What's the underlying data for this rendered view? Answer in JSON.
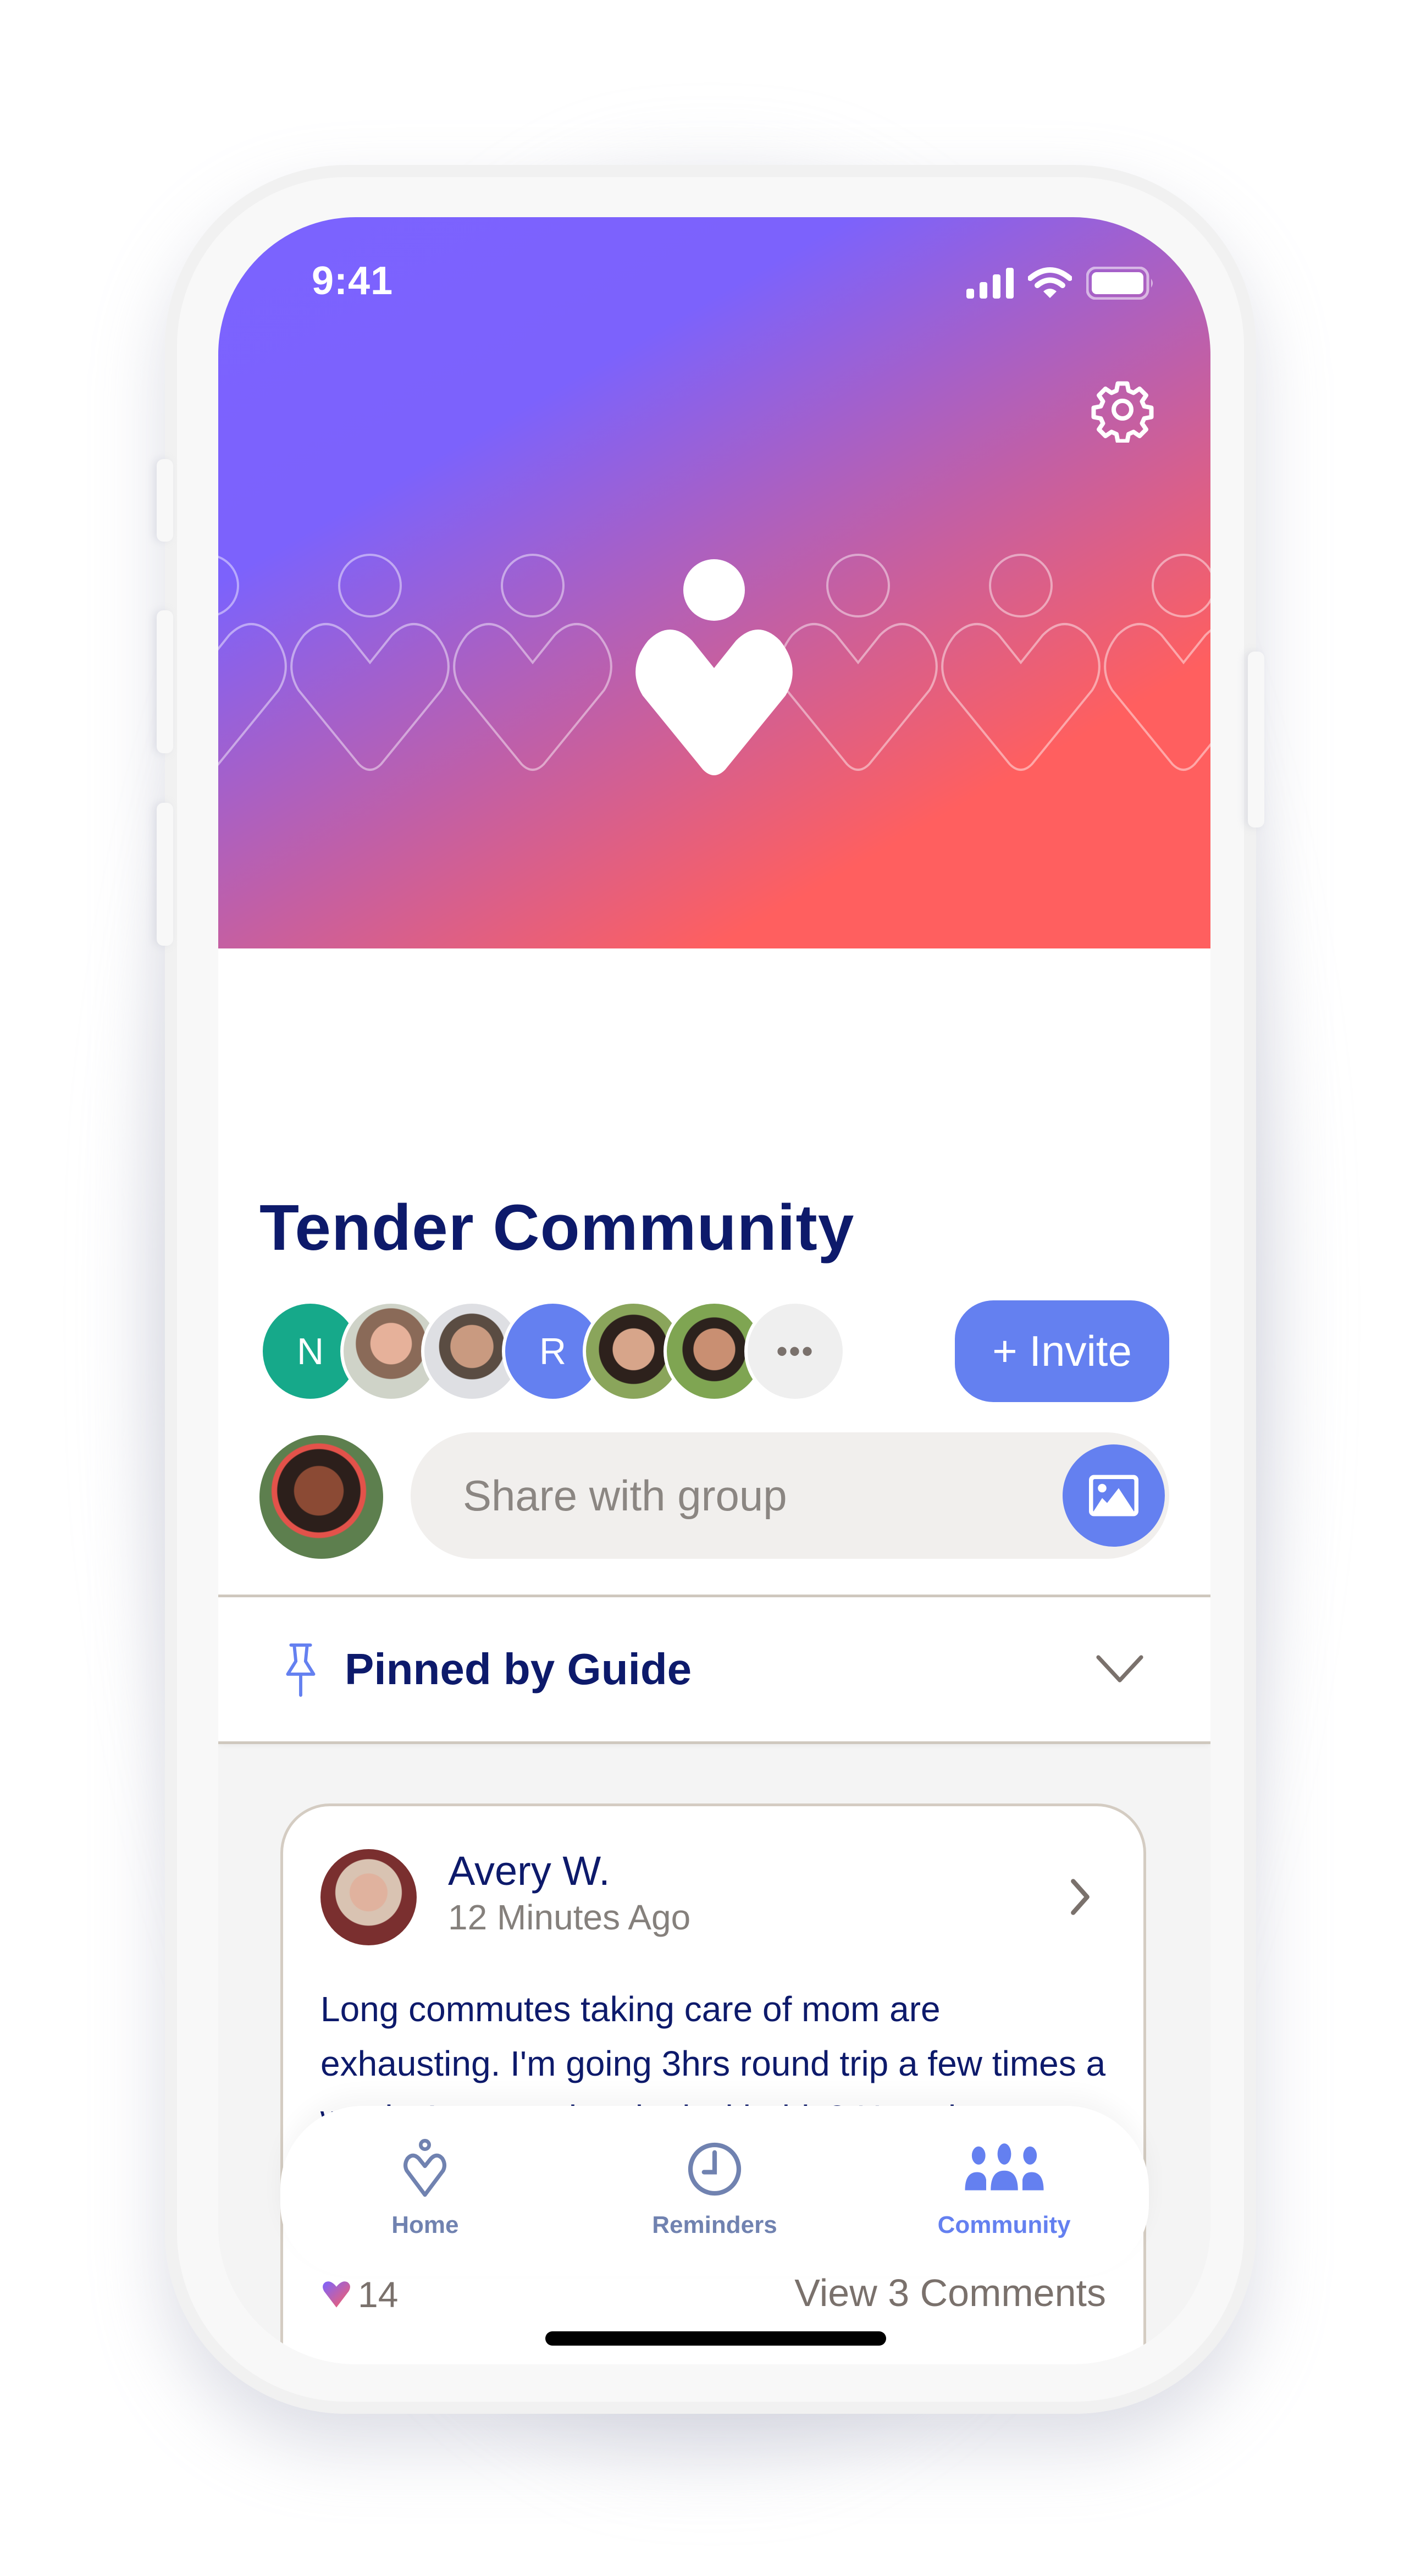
{
  "status_bar": {
    "time": "9:41",
    "icons": [
      "cellular-signal-icon",
      "wifi-icon",
      "battery-icon"
    ]
  },
  "header": {
    "settings_icon": "gear-icon",
    "logo": "heart-person-logo",
    "gradient_colors": [
      "#7b63ff",
      "#ff5f5f"
    ]
  },
  "group": {
    "title": "Tender Community",
    "members": [
      {
        "type": "initial",
        "initial": "N",
        "color": "#16a98a"
      },
      {
        "type": "photo"
      },
      {
        "type": "photo"
      },
      {
        "type": "initial",
        "initial": "R",
        "color": "#6480f0"
      },
      {
        "type": "photo"
      },
      {
        "type": "photo"
      }
    ],
    "more_label": "•••",
    "invite_label": "+ Invite"
  },
  "composer": {
    "placeholder": "Share with group",
    "photo_button_icon": "image-icon"
  },
  "pinned": {
    "label": "Pinned by Guide",
    "icon": "pin-icon",
    "expand_icon": "chevron-down-icon"
  },
  "post": {
    "author": "Avery W.",
    "time": "12 Minutes Ago",
    "body": "Long commutes taking care of mom are exhausting. I'm going 3hrs round trip a few times a week. Anyone else deal with this? How do you make the most of your trips?",
    "likes": "14",
    "comments_label": "View 3 Comments"
  },
  "tabbar": {
    "tabs": [
      {
        "label": "Home",
        "icon": "home-heart-icon",
        "active": false
      },
      {
        "label": "Reminders",
        "icon": "clock-icon",
        "active": false
      },
      {
        "label": "Community",
        "icon": "people-icon",
        "active": true
      }
    ]
  },
  "colors": {
    "accent": "#6480f0",
    "navy": "#0d1a6b",
    "muted": "#7a716c",
    "teal": "#16a98a",
    "coral": "#ff5f5f",
    "violet": "#7b63ff"
  }
}
